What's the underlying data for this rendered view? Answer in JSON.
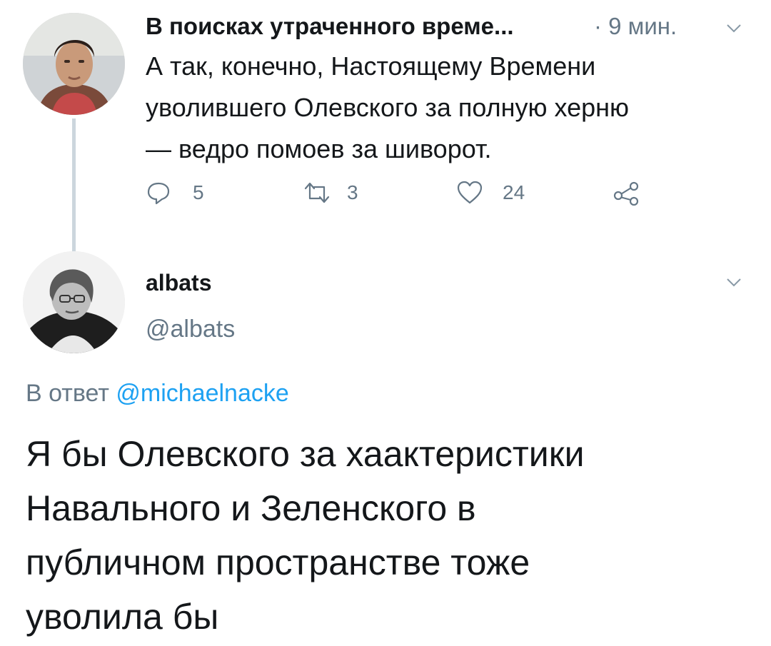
{
  "parent_tweet": {
    "author_name": "В поисках утраченного време...",
    "time": "· 9 мин.",
    "text_lines": [
      "А так, конечно, Настоящему Времени",
      "уволившего Олевского за полную херню",
      "— ведро помоев за шиворот."
    ],
    "reply_count": "5",
    "retweet_count": "3",
    "like_count": "24"
  },
  "main_tweet": {
    "author_name": "albats",
    "handle": "@albats",
    "reply_prefix": "В ответ",
    "reply_to_handle": "@michaelnacke",
    "text_lines": [
      "Я бы Олевского за хаактеристики",
      "Навального и Зеленского в",
      "публичном пространстве тоже",
      "уволила бы"
    ]
  },
  "colors": {
    "text": "#14171a",
    "secondary": "#657786",
    "link": "#1da1f2",
    "thread_line": "#ccd6dd"
  }
}
